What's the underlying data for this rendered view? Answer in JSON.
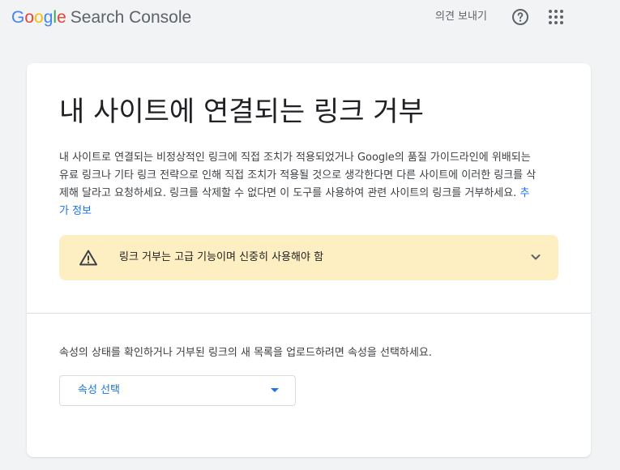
{
  "header": {
    "logo_letters": [
      {
        "char": "G",
        "color": "#4285f4"
      },
      {
        "char": "o",
        "color": "#ea4335"
      },
      {
        "char": "o",
        "color": "#fbbc05"
      },
      {
        "char": "g",
        "color": "#4285f4"
      },
      {
        "char": "l",
        "color": "#34a853"
      },
      {
        "char": "e",
        "color": "#ea4335"
      }
    ],
    "product_name": "Search Console",
    "feedback_label": "의견 보내기",
    "help_icon": "help-circle-icon",
    "apps_icon": "apps-grid-icon"
  },
  "main": {
    "title": "내 사이트에 연결되는 링크 거부",
    "description": "내 사이트로 연결되는 비정상적인 링크에 직접 조치가 적용되었거나 Google의 품질 가이드라인에 위배되는 유료 링크나 기타 링크 전략으로 인해 직접 조치가 적용될 것으로 생각한다면 다른 사이트에 이러한 링크를 삭제해 달라고 요청하세요. 링크를 삭제할 수 없다면 이 도구를 사용하여 관련 사이트의 링크를 거부하세요.",
    "learn_more_label": "추가 정보",
    "warning": {
      "text": "링크 거부는 고급 기능이며 신중히 사용해야 함",
      "icon": "warning-triangle-icon",
      "expand_icon": "chevron-down-icon"
    },
    "instruction": "속성의 상태를 확인하거나 거부된 링크의 새 목록을 업로드하려면 속성을 선택하세요.",
    "property_select": {
      "label": "속성 선택",
      "icon": "dropdown-arrow-icon"
    }
  },
  "colors": {
    "background": "#f1f3f4",
    "link_blue": "#1a73e8",
    "warning_bg": "#feefc3",
    "text_primary": "#202124",
    "text_secondary": "#5f6368"
  }
}
